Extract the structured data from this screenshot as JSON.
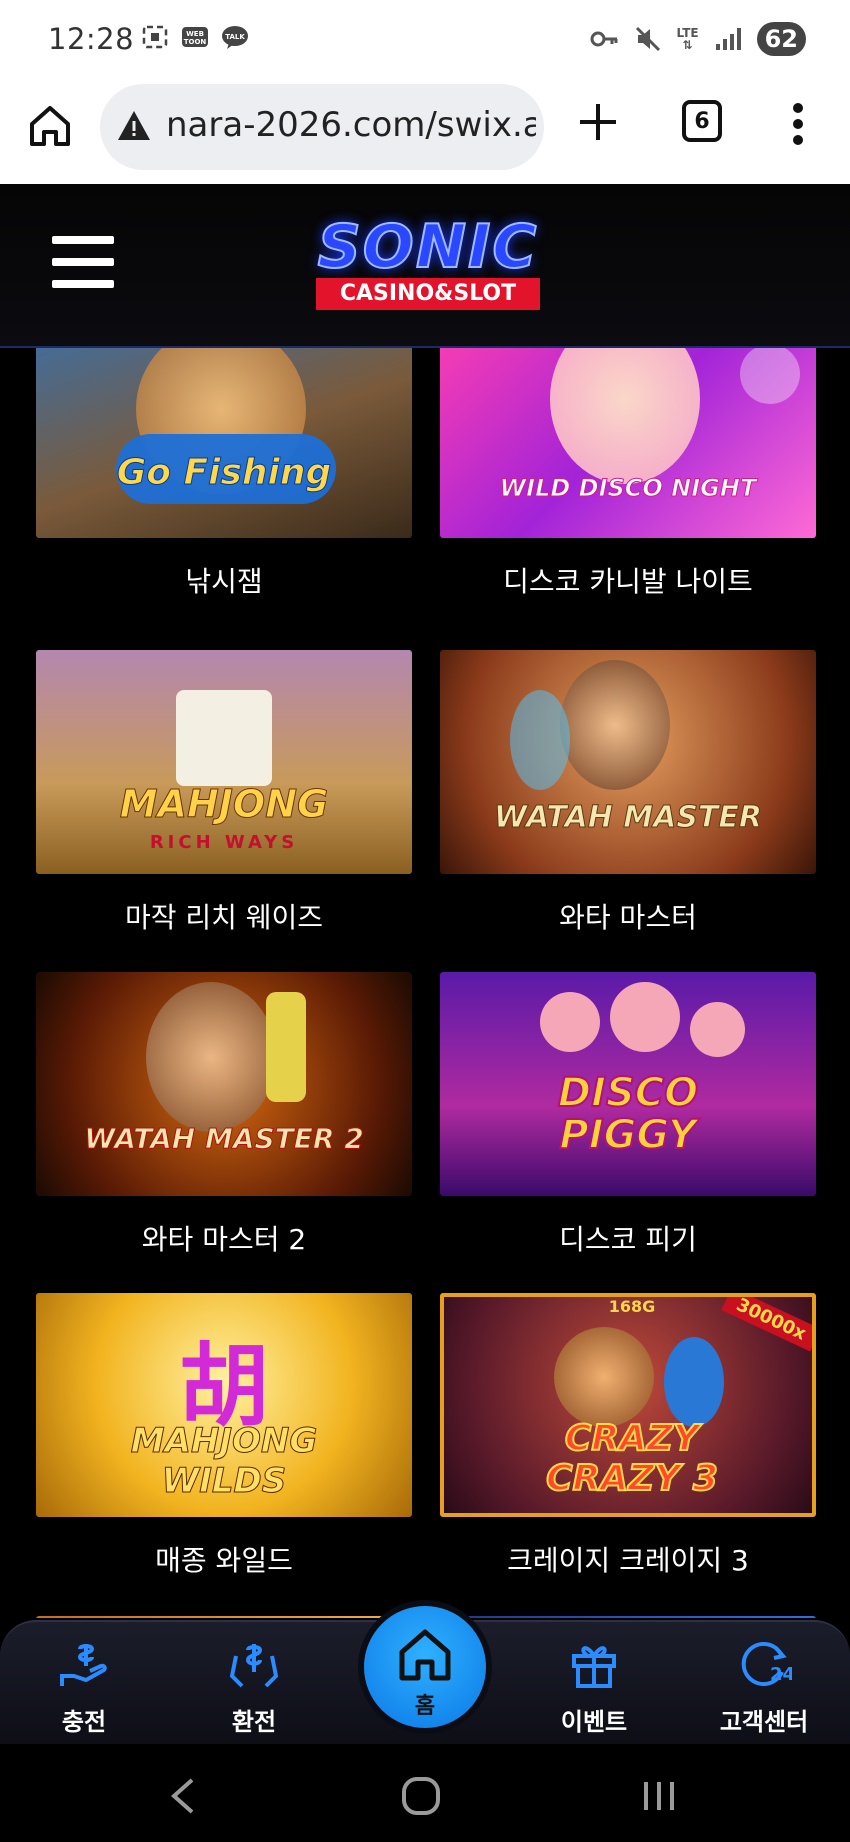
{
  "status_bar": {
    "time": "12:28",
    "network": "LTE",
    "battery": "62",
    "icons": [
      "screenshot-icon",
      "webtoon-icon",
      "talk-icon",
      "key-icon",
      "mute-icon",
      "lte-icon",
      "signal-icon",
      "battery-icon"
    ],
    "webtoon_text": "WEB TOON",
    "talk_text": "TALK"
  },
  "browser": {
    "url": "nara-2026.com/swix.a",
    "tab_count": "6",
    "icons": [
      "home-icon",
      "not-secure-warning-icon",
      "new-tab-plus-icon",
      "tab-switcher-icon",
      "more-vert-icon"
    ]
  },
  "site": {
    "logo_word": "SONIC",
    "logo_sub": "CASINO&SLOT"
  },
  "games": [
    {
      "name": "낚시잼",
      "art_text": "Go Fishing"
    },
    {
      "name": "디스코 카니발 나이트",
      "art_text": "WILD DISCO NIGHT"
    },
    {
      "name": "마작 리치 웨이즈",
      "art_text": "MAHJONG",
      "art_sub": "RICH WAYS"
    },
    {
      "name": "와타 마스터",
      "art_text": "WATAH MASTER"
    },
    {
      "name": "와타 마스터 2",
      "art_text": "WATAH MASTER 2"
    },
    {
      "name": "디스코 피기",
      "art_text": "DISCO PIGGY"
    },
    {
      "name": "매종 와일드",
      "art_text": "MAHJONG WILDS",
      "art_glyph": "胡"
    },
    {
      "name": "크레이지 크레이지 3",
      "art_text": "CRAZY CRAZY 3",
      "art_badge": "30000x",
      "art_top": "168G"
    }
  ],
  "bottom_nav": {
    "items": [
      {
        "label": "충전",
        "icon": "deposit-icon"
      },
      {
        "label": "환전",
        "icon": "exchange-icon"
      },
      {
        "label": "홈",
        "icon": "home-icon"
      },
      {
        "label": "이벤트",
        "icon": "gift-icon"
      },
      {
        "label": "고객센터",
        "icon": "support-24-icon"
      }
    ]
  },
  "system_nav": {
    "icons": [
      "back-icon",
      "home-circle-icon",
      "recents-icon"
    ]
  },
  "colors": {
    "accent_blue": "#0a78e6",
    "logo_red": "#e3132b",
    "page_bg": "#000000"
  }
}
